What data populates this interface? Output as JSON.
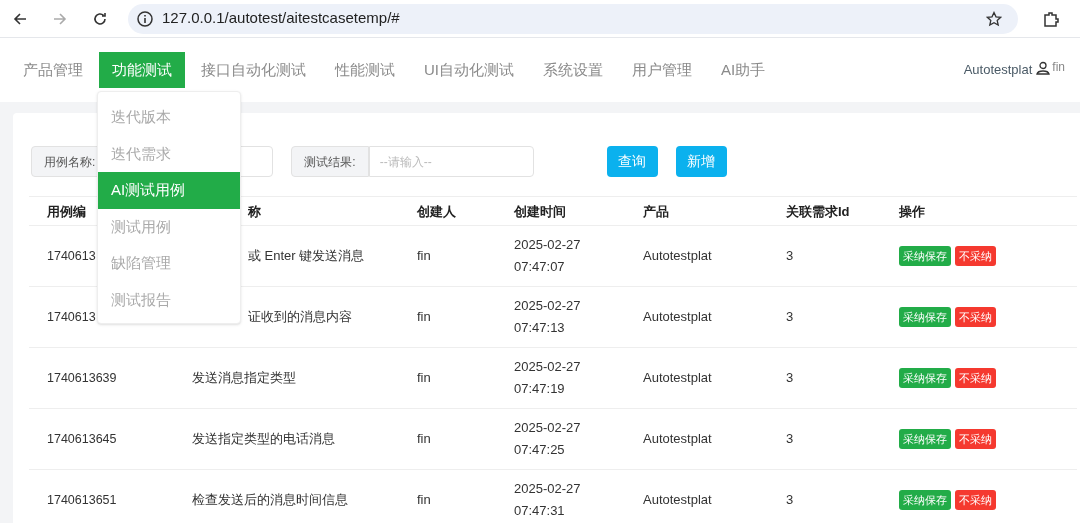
{
  "browser": {
    "url": "127.0.0.1/autotest/aitestcasetemp/#"
  },
  "nav": {
    "items": [
      {
        "label": "产品管理",
        "selected": false
      },
      {
        "label": "功能测试",
        "selected": true
      },
      {
        "label": "接口自动化测试",
        "selected": false
      },
      {
        "label": "性能测试",
        "selected": false
      },
      {
        "label": "UI自动化测试",
        "selected": false
      },
      {
        "label": "系统设置",
        "selected": false
      },
      {
        "label": "用户管理",
        "selected": false
      },
      {
        "label": "AI助手",
        "selected": false
      }
    ],
    "product": "Autotestplat",
    "user": "fin"
  },
  "dropdown": [
    {
      "label": "迭代版本",
      "selected": false
    },
    {
      "label": "迭代需求",
      "selected": false
    },
    {
      "label": "AI测试用例",
      "selected": true
    },
    {
      "label": "测试用例",
      "selected": false
    },
    {
      "label": "缺陷管理",
      "selected": false
    },
    {
      "label": "测试报告",
      "selected": false
    }
  ],
  "filters": [
    {
      "label": "用例名称:"
    },
    {
      "label": "测试结果:",
      "placeholder": "--请输入--"
    }
  ],
  "buttons": [
    "查询",
    "新增"
  ],
  "table": {
    "columns": [
      {
        "label": "用例编"
      },
      {
        "label": "称",
        "covered": true
      },
      {
        "label": "创建人"
      },
      {
        "label": "创建时间"
      },
      {
        "label": "产品"
      },
      {
        "label": "关联需求Id"
      },
      {
        "label": "操作"
      }
    ],
    "rows": [
      {
        "id": "1740613",
        "name": "或 Enter 键发送消息",
        "name_covered": true,
        "creator": "fin",
        "date": "2025-02-27",
        "time": "07:47:07",
        "product": "Autotestplat",
        "req": "3",
        "accept": "采纳保存",
        "reject": "不采纳"
      },
      {
        "id": "1740613",
        "name": "证收到的消息内容",
        "name_covered": true,
        "creator": "fin",
        "date": "2025-02-27",
        "time": "07:47:13",
        "product": "Autotestplat",
        "req": "3",
        "accept": "采纳保存",
        "reject": "不采纳"
      },
      {
        "id": "1740613639",
        "name": "发送消息指定类型",
        "creator": "fin",
        "date": "2025-02-27",
        "time": "07:47:19",
        "product": "Autotestplat",
        "req": "3",
        "accept": "采纳保存",
        "reject": "不采纳"
      },
      {
        "id": "1740613645",
        "name": "发送指定类型的电话消息",
        "creator": "fin",
        "date": "2025-02-27",
        "time": "07:47:25",
        "product": "Autotestplat",
        "req": "3",
        "accept": "采纳保存",
        "reject": "不采纳"
      },
      {
        "id": "1740613651",
        "name": "检查发送后的消息时间信息",
        "creator": "fin",
        "date": "2025-02-27",
        "time": "07:47:31",
        "product": "Autotestplat",
        "req": "3",
        "accept": "采纳保存",
        "reject": "不采纳"
      }
    ]
  }
}
